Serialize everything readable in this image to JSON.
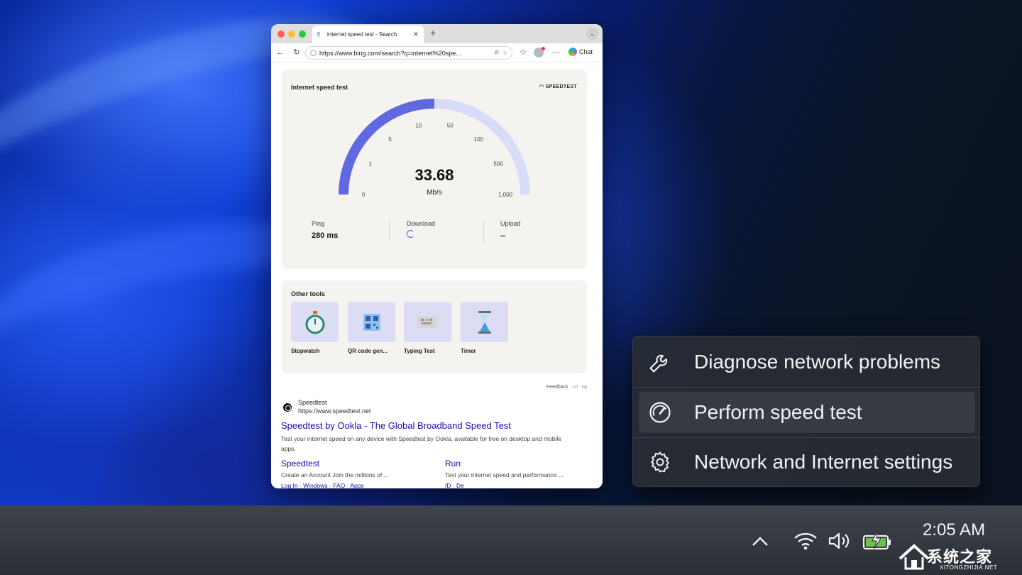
{
  "browser": {
    "tab_title": "internet speed test - Search",
    "url": "https://www.bing.com/search?q=internet%20spe...",
    "chat_label": "Chat"
  },
  "speed_test": {
    "title": "Internet speed test",
    "brand": "SPEEDTEST",
    "speed_value": "33.68",
    "speed_unit": "Mb/s",
    "gauge_ticks": [
      "0",
      "1",
      "5",
      "10",
      "50",
      "100",
      "500",
      "1,000"
    ],
    "gauge_fill_fraction": 0.5,
    "ping_label": "Ping",
    "ping_value": "280 ms",
    "download_label": "Download",
    "upload_label": "Upload",
    "upload_value": "--",
    "accent_color": "#6169e0",
    "track_color": "#d9dcf8"
  },
  "tools": {
    "title": "Other tools",
    "items": [
      {
        "name": "Stopwatch",
        "icon": "stopwatch-icon"
      },
      {
        "name": "QR code gen...",
        "icon": "qr-code-icon"
      },
      {
        "name": "Typing Test",
        "icon": "keyboard-icon"
      },
      {
        "name": "Timer",
        "icon": "hourglass-icon"
      }
    ]
  },
  "feedback_label": "Feedback",
  "result": {
    "site_name": "Speedtest",
    "site_url": "https://www.speedtest.net",
    "title": "Speedtest by Ookla - The Global Broadband Speed Test",
    "description": "Test your internet speed on any device with Speedtest by Ookla, available for free on desktop and mobile apps.",
    "sublinks": [
      {
        "title": "Speedtest",
        "desc": "Create an Account Join the millions of ...",
        "links": "Log In · Windows · FAQ · Apps"
      },
      {
        "title": "Run",
        "desc": "Test your internet speed and performance ...",
        "links": "ID · De"
      }
    ]
  },
  "context_menu": {
    "items": [
      {
        "label": "Diagnose network problems",
        "icon": "wrench-icon"
      },
      {
        "label": "Perform speed test",
        "icon": "speedometer-icon"
      },
      {
        "label": "Network and Internet settings",
        "icon": "gear-icon"
      }
    ]
  },
  "taskbar": {
    "time": "2:05 AM",
    "icons": [
      "chevron-up-icon",
      "wifi-icon",
      "volume-icon",
      "battery-charging-icon"
    ]
  },
  "watermark": {
    "text": "系统之家",
    "subtext": "XITONGZHIJIA.NET"
  }
}
